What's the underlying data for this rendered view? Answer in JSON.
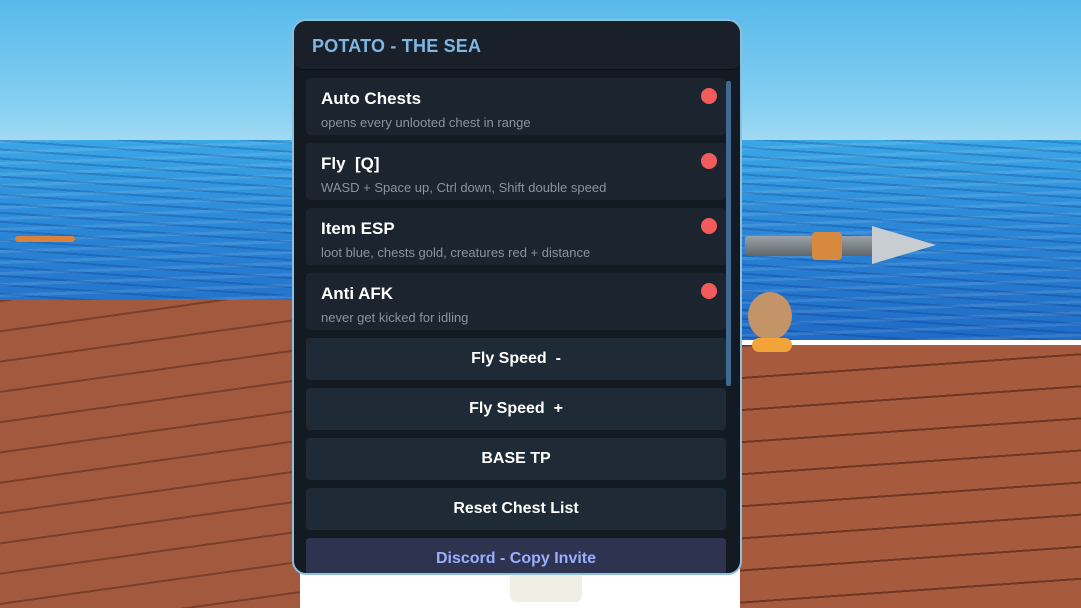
{
  "panel": {
    "title": "POTATO - THE SEA",
    "toggles": [
      {
        "label": "Auto Chests",
        "description": "opens every unlooted chest in range",
        "state_color": "#f25b5b"
      },
      {
        "label": "Fly  [Q]",
        "description": "WASD + Space up, Ctrl down, Shift double speed",
        "state_color": "#f25b5b"
      },
      {
        "label": "Item ESP",
        "description": "loot blue, chests gold, creatures red + distance",
        "state_color": "#f25b5b"
      },
      {
        "label": "Anti AFK",
        "description": "never get kicked for idling",
        "state_color": "#f25b5b"
      }
    ],
    "buttons": [
      {
        "label": "Fly Speed  -"
      },
      {
        "label": "Fly Speed  +"
      },
      {
        "label": "BASE TP"
      },
      {
        "label": "Reset Chest List"
      },
      {
        "label": "Discord - Copy Invite"
      }
    ]
  },
  "colors": {
    "panel_bg": "#141a22",
    "panel_border": "#8ebfdc",
    "title_text": "#7fb6e2",
    "toggle_off": "#f25b5b",
    "discord_accent": "#9ab0ff"
  }
}
